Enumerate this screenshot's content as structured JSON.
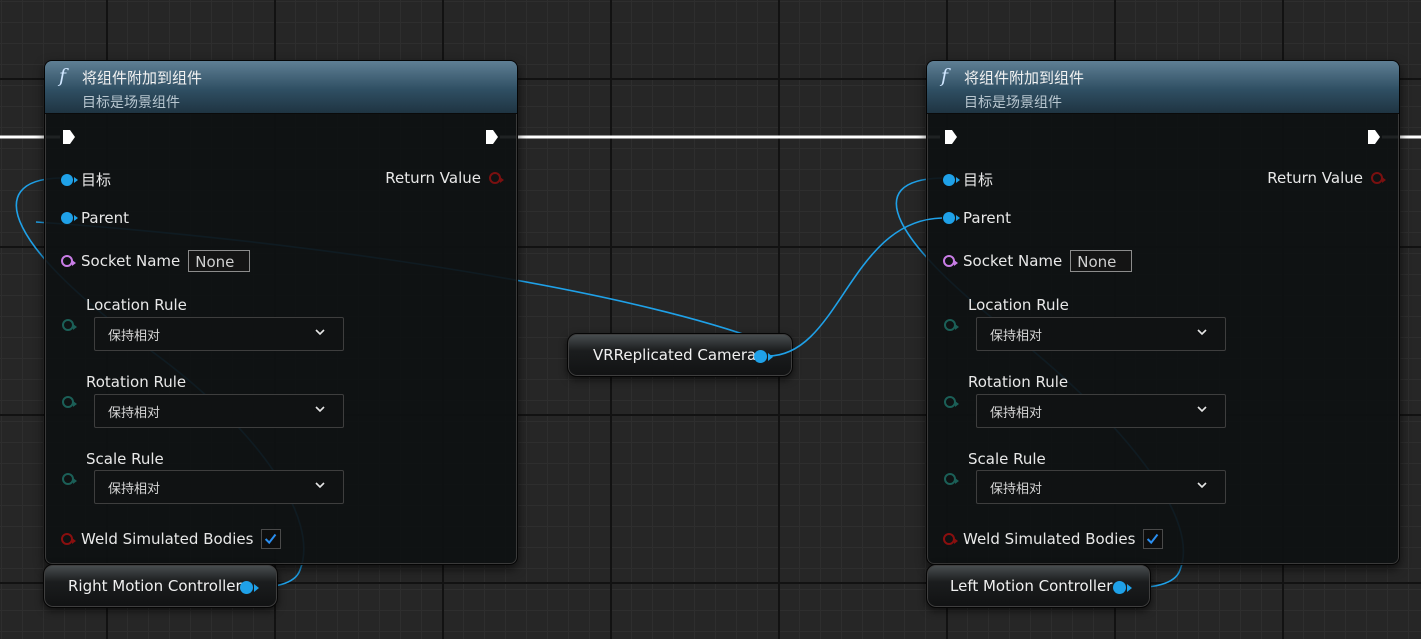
{
  "colors": {
    "object_wire": "#1fa1e8",
    "exec_wire": "#ffffff",
    "header_blue": "#2f4f63",
    "name_pin": "#c97de6",
    "enum_pin": "#1b5f57",
    "bool_pin": "#8a0f0f"
  },
  "nodes": [
    {
      "function_icon": "f",
      "title": "将组件附加到组件",
      "subtitle": "目标是场景组件",
      "target_label": "目标",
      "return_label": "Return Value",
      "parent_label": "Parent",
      "socket_label": "Socket Name",
      "socket_value": "None",
      "location_rule_label": "Location Rule",
      "location_rule_value": "保持相对",
      "rotation_rule_label": "Rotation Rule",
      "rotation_rule_value": "保持相对",
      "scale_rule_label": "Scale Rule",
      "scale_rule_value": "保持相对",
      "weld_label": "Weld Simulated Bodies",
      "weld_checked": true
    },
    {
      "function_icon": "f",
      "title": "将组件附加到组件",
      "subtitle": "目标是场景组件",
      "target_label": "目标",
      "return_label": "Return Value",
      "parent_label": "Parent",
      "socket_label": "Socket Name",
      "socket_value": "None",
      "location_rule_label": "Location Rule",
      "location_rule_value": "保持相对",
      "rotation_rule_label": "Rotation Rule",
      "rotation_rule_value": "保持相对",
      "scale_rule_label": "Scale Rule",
      "scale_rule_value": "保持相对",
      "weld_label": "Weld Simulated Bodies",
      "weld_checked": true
    }
  ],
  "variables": {
    "camera": "VRReplicated Camera",
    "right_controller": "Right Motion Controller",
    "left_controller": "Left Motion Controller"
  },
  "icons": {
    "function": "function-icon",
    "exec": "exec-pin-icon",
    "dropdown": "chevron-down-icon",
    "check": "checkmark-icon"
  }
}
